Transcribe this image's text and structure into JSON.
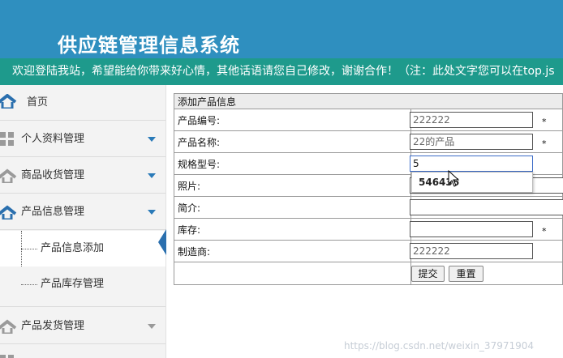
{
  "header": {
    "title": "供应链管理信息系统"
  },
  "marquee": {
    "text": "欢迎登陆我站，希望能给你带来好心情，其他话语请您自己修改，谢谢合作！（注：此处文字您可以在top.js"
  },
  "sidebar": {
    "home": "首页",
    "items": [
      {
        "label": "个人资料管理"
      },
      {
        "label": "商品收货管理"
      },
      {
        "label": "产品信息管理"
      },
      {
        "label": "产品发货管理"
      }
    ],
    "sub_items": [
      {
        "label": "产品信息添加"
      },
      {
        "label": "产品库存管理"
      }
    ]
  },
  "form": {
    "heading": "添加产品信息",
    "fields": [
      {
        "label": "产品编号:",
        "value": "222222"
      },
      {
        "label": "产品名称:",
        "value": "22的产品"
      },
      {
        "label": "规格型号:",
        "value": "5"
      },
      {
        "label": "照片:",
        "value": ""
      },
      {
        "label": "简介:",
        "value": ""
      },
      {
        "label": "库存:",
        "value": ""
      },
      {
        "label": "制造商:",
        "value": "222222"
      }
    ],
    "required_mark": "*",
    "submit_label": "提交",
    "reset_label": "重置",
    "autocomplete_suggestion": "546436"
  },
  "watermark": "https://blog.csdn.net/weixin_37971904",
  "colors": {
    "header": "#2f8fbf",
    "marquee": "#1e9a8c",
    "accent": "#2a7ab8"
  }
}
